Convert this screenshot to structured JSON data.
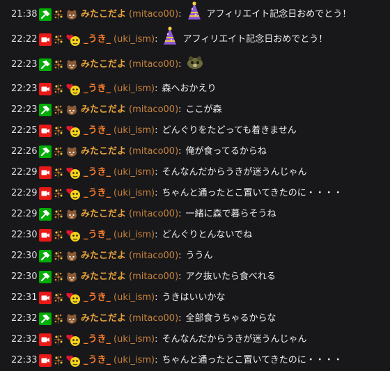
{
  "colors": {
    "background": "#18181b",
    "mitaco": "#e8a33a",
    "uki": "#ff7f2a",
    "login": "#c6823a",
    "moderator_badge": "#00ad03",
    "broadcaster_badge": "#e91916"
  },
  "messages": [
    {
      "time": "21:38",
      "badge": "moderator",
      "sub": "brown",
      "name": "みたこだよ",
      "login": "(mitaco00)",
      "text": "アフィリエイト記念日おめでとう！",
      "emote": "party-hat"
    },
    {
      "time": "22:22",
      "badge": "broadcaster",
      "sub": "heart",
      "name": "_うき_",
      "login": "(uki_ism)",
      "text": "アフィリエイト記念日おめでとう！",
      "emote": "party-hat"
    },
    {
      "time": "22:23",
      "badge": "moderator",
      "sub": "brown",
      "name": "みたこだよ",
      "login": "(mitaco00)",
      "text": "",
      "emote": "tanuki"
    },
    {
      "time": "22:23",
      "badge": "broadcaster",
      "sub": "heart",
      "name": "_うき_",
      "login": "(uki_ism)",
      "text": "森へおかえり"
    },
    {
      "time": "22:23",
      "badge": "moderator",
      "sub": "brown",
      "name": "みたこだよ",
      "login": "(mitaco00)",
      "text": "ここが森"
    },
    {
      "time": "22:25",
      "badge": "broadcaster",
      "sub": "heart",
      "name": "_うき_",
      "login": "(uki_ism)",
      "text": "どんぐりをたどっても着きません"
    },
    {
      "time": "22:26",
      "badge": "moderator",
      "sub": "brown",
      "name": "みたこだよ",
      "login": "(mitaco00)",
      "text": "俺が食ってるからね"
    },
    {
      "time": "22:29",
      "badge": "broadcaster",
      "sub": "heart",
      "name": "_うき_",
      "login": "(uki_ism)",
      "text": "そんなんだからうきが迷うんじゃん"
    },
    {
      "time": "22:29",
      "badge": "broadcaster",
      "sub": "heart",
      "name": "_うき_",
      "login": "(uki_ism)",
      "text": "ちゃんと通ったとこ置いてきたのに・・・・"
    },
    {
      "time": "22:29",
      "badge": "moderator",
      "sub": "brown",
      "name": "みたこだよ",
      "login": "(mitaco00)",
      "text": "一緒に森で暮らそうね"
    },
    {
      "time": "22:30",
      "badge": "broadcaster",
      "sub": "heart",
      "name": "_うき_",
      "login": "(uki_ism)",
      "text": "どんぐりとんないでね"
    },
    {
      "time": "22:30",
      "badge": "moderator",
      "sub": "brown",
      "name": "みたこだよ",
      "login": "(mitaco00)",
      "text": "ううん"
    },
    {
      "time": "22:30",
      "badge": "moderator",
      "sub": "brown",
      "name": "みたこだよ",
      "login": "(mitaco00)",
      "text": "アク抜いたら食べれる"
    },
    {
      "time": "22:31",
      "badge": "broadcaster",
      "sub": "heart",
      "name": "_うき_",
      "login": "(uki_ism)",
      "text": "うきはいいかな"
    },
    {
      "time": "22:32",
      "badge": "moderator",
      "sub": "brown",
      "name": "みたこだよ",
      "login": "(mitaco00)",
      "text": "全部食うちゃるからな"
    },
    {
      "time": "22:32",
      "badge": "broadcaster",
      "sub": "heart",
      "name": "_うき_",
      "login": "(uki_ism)",
      "text": "そんなんだからうきが迷うんじゃん"
    },
    {
      "time": "22:33",
      "badge": "broadcaster",
      "sub": "heart",
      "name": "_うき_",
      "login": "(uki_ism)",
      "text": "ちゃんと通ったとこ置いてきたのに・・・・"
    }
  ]
}
